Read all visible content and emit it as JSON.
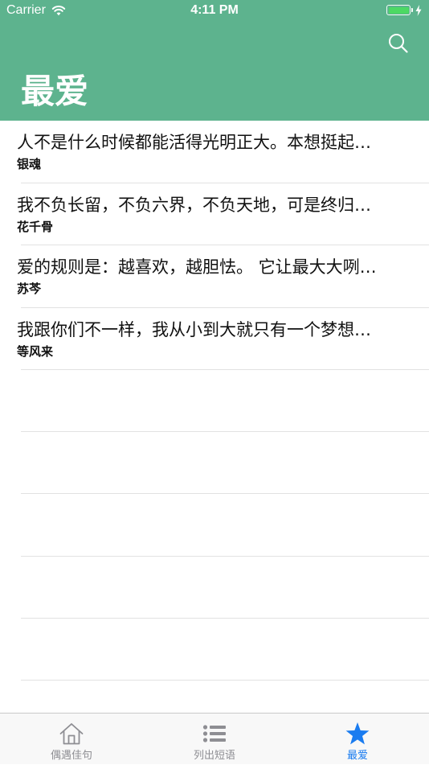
{
  "status_bar": {
    "carrier": "Carrier",
    "time": "4:11 PM"
  },
  "header": {
    "title": "最爱",
    "background": "#5db38e",
    "search_icon": "search-icon"
  },
  "quotes": [
    {
      "text": "人不是什么时候都能活得光明正大。本想挺起…",
      "author": "银魂"
    },
    {
      "text": "我不负长留，不负六界，不负天地，可是终归…",
      "author": "花千骨"
    },
    {
      "text": "爱的规则是：越喜欢，越胆怯。 它让最大大咧…",
      "author": "苏芩"
    },
    {
      "text": "我跟你们不一样，我从小到大就只有一个梦想…",
      "author": "等风来"
    }
  ],
  "tabbar": {
    "active_color": "#1a7cf0",
    "inactive_color": "#8e8e93",
    "tabs": [
      {
        "label": "偶遇佳句",
        "icon": "home-icon",
        "active": false
      },
      {
        "label": "列出短语",
        "icon": "list-icon",
        "active": false
      },
      {
        "label": "最爱",
        "icon": "star-icon",
        "active": true
      }
    ]
  }
}
